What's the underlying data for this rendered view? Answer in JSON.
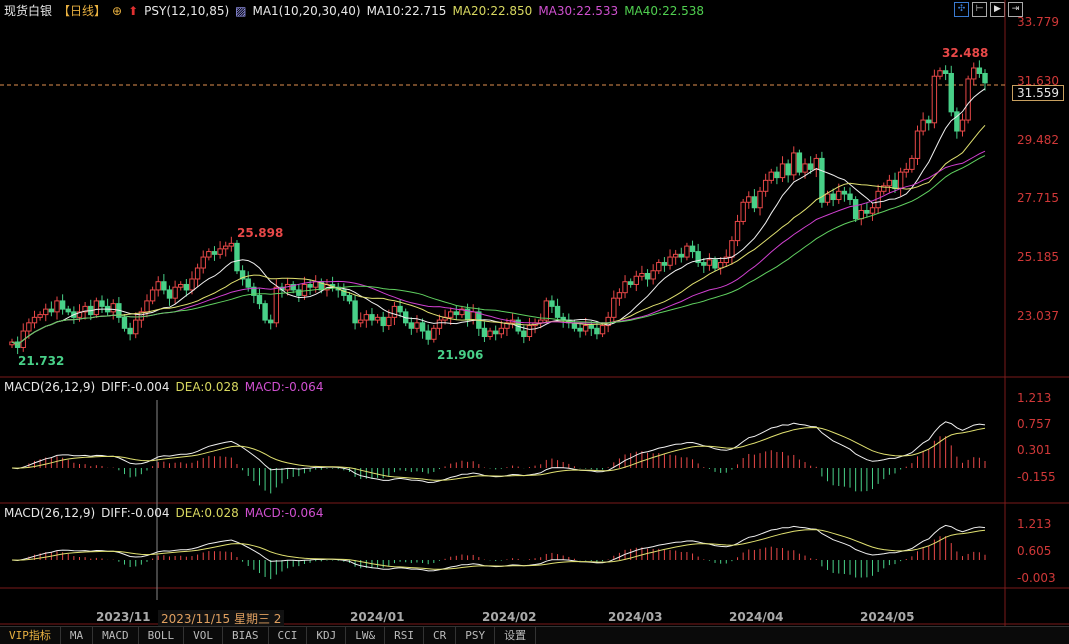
{
  "header": {
    "title": "现货白银",
    "period": "【日线】",
    "psy": "PSY(12,10,85)",
    "ma_set": "MA1(10,20,30,40)",
    "ma10": "MA10:22.715",
    "ma20": "MA20:22.850",
    "ma30": "MA30:22.533",
    "ma40": "MA40:22.538"
  },
  "macd1": {
    "name": "MACD(26,12,9)",
    "diff": "DIFF:-0.004",
    "dea": "DEA:0.028",
    "macd": "MACD:-0.064",
    "ticks": [
      "1.213",
      "0.757",
      "0.301",
      "-0.155"
    ]
  },
  "macd2": {
    "name": "MACD(26,12,9)",
    "diff": "DIFF:-0.004",
    "dea": "DEA:0.028",
    "macd": "MACD:-0.064",
    "ticks": [
      "1.213",
      "0.605",
      "-0.003"
    ]
  },
  "price_axis": [
    "33.779",
    "31.630",
    "29.482",
    "27.715",
    "25.185",
    "23.037"
  ],
  "last_price": "31.559",
  "annotations": {
    "high1": "25.898",
    "low1": "21.732",
    "low2": "21.906",
    "high2": "32.488"
  },
  "dates": [
    "2023/11",
    "2024/01",
    "2024/02",
    "2024/03",
    "2024/04",
    "2024/05"
  ],
  "tooltip": "2023/11/15 星期三 2",
  "tabs": [
    "VIP指标",
    "MA",
    "MACD",
    "BOLL",
    "VOL",
    "BIAS",
    "CCI",
    "KDJ",
    "LW&",
    "RSI",
    "CR",
    "PSY",
    "设置"
  ],
  "colors": {
    "up": "#e84848",
    "down": "#48d088",
    "ma10": "#f0f0f0",
    "ma20": "#e0e070",
    "ma30": "#d040d0",
    "ma40": "#60d060"
  },
  "chart_data": {
    "type": "candlestick",
    "title": "现货白银 日线",
    "ylim": [
      21.5,
      33.779
    ],
    "close": [
      22.1,
      21.9,
      22.5,
      22.8,
      23.0,
      23.1,
      23.3,
      23.2,
      23.6,
      23.3,
      23.2,
      23.0,
      23.2,
      23.4,
      23.1,
      23.6,
      23.4,
      23.2,
      23.5,
      23.0,
      22.6,
      22.4,
      22.9,
      23.2,
      23.6,
      24.0,
      24.3,
      24.0,
      23.7,
      24.1,
      24.2,
      24.0,
      24.4,
      24.8,
      25.2,
      25.4,
      25.3,
      25.5,
      25.6,
      25.7,
      24.7,
      24.4,
      24.1,
      23.8,
      23.5,
      22.9,
      22.8,
      24.1,
      24.0,
      24.2,
      24.0,
      23.8,
      24.2,
      24.1,
      24.3,
      24.0,
      24.2,
      24.1,
      24.0,
      23.8,
      23.6,
      22.8,
      22.9,
      23.1,
      22.9,
      23.0,
      22.7,
      23.0,
      23.4,
      23.2,
      22.8,
      22.6,
      22.8,
      22.5,
      22.2,
      22.6,
      22.9,
      23.0,
      23.2,
      23.1,
      23.3,
      22.9,
      23.2,
      22.6,
      22.3,
      22.5,
      22.4,
      22.6,
      22.8,
      22.9,
      22.5,
      22.3,
      22.7,
      22.8,
      22.9,
      23.6,
      23.4,
      23.0,
      22.9,
      22.8,
      22.6,
      22.5,
      22.7,
      22.6,
      22.4,
      22.7,
      23.0,
      23.7,
      23.9,
      24.3,
      24.2,
      24.5,
      24.6,
      24.4,
      24.7,
      25.0,
      24.9,
      25.2,
      25.3,
      25.2,
      25.6,
      25.4,
      25.0,
      24.9,
      25.1,
      24.8,
      25.0,
      25.2,
      25.8,
      26.5,
      27.2,
      27.4,
      27.0,
      27.6,
      28.0,
      28.3,
      28.1,
      28.6,
      28.2,
      29.0,
      28.3,
      28.6,
      28.4,
      28.8,
      27.2,
      27.5,
      27.3,
      27.6,
      27.5,
      27.3,
      26.6,
      26.9,
      26.8,
      27.0,
      27.6,
      27.8,
      28.0,
      27.7,
      28.3,
      28.4,
      28.8,
      29.8,
      30.2,
      30.1,
      31.8,
      32.0,
      31.9,
      30.5,
      29.8,
      30.2,
      31.7,
      32.1,
      31.9,
      31.559
    ],
    "ma_periods": [
      10,
      20,
      30,
      40
    ],
    "macd_params": [
      26,
      12,
      9
    ]
  }
}
